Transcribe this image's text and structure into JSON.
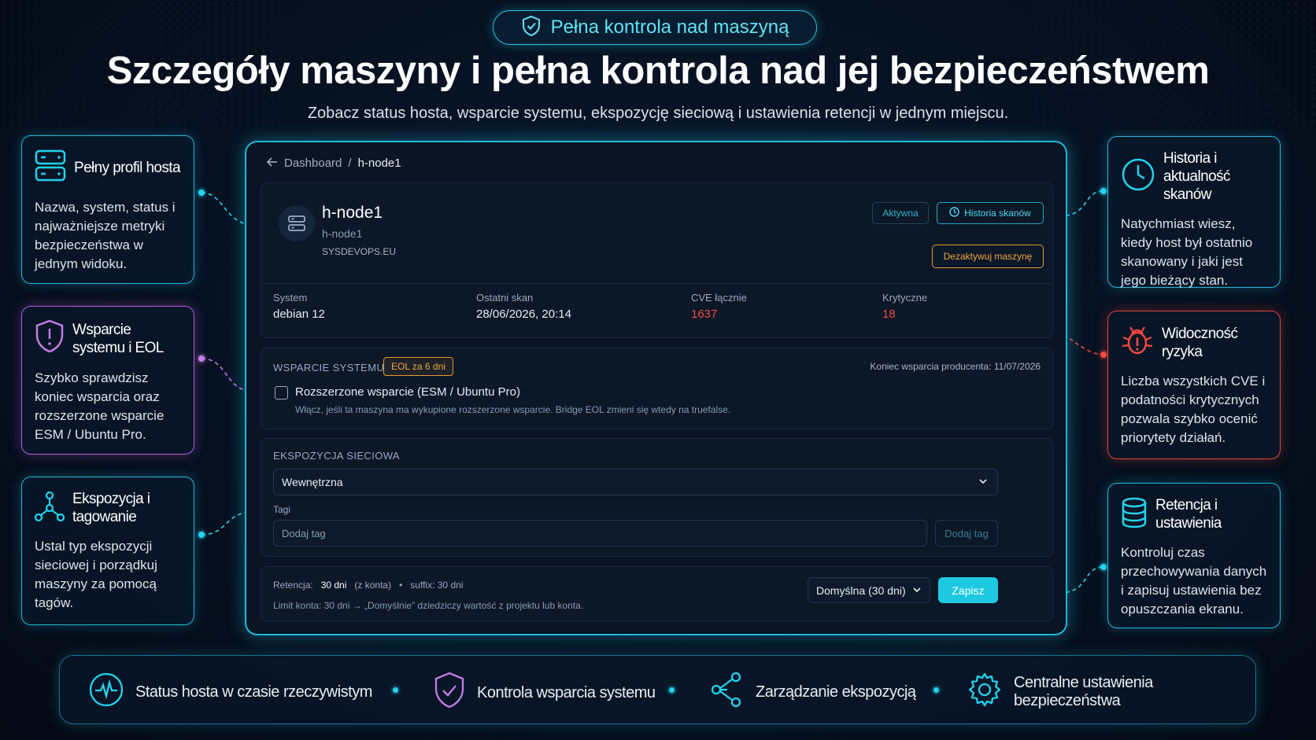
{
  "header": {
    "badge": "Pełna kontrola nad maszyną",
    "title": "Szczegóły maszyny i pełna kontrola nad jej bezpieczeństwem",
    "subtitle": "Zobacz status hosta, wsparcie systemu, ekspozycję sieciową i ustawienia retencji w jednym miejscu."
  },
  "left_cards": [
    {
      "title": "Pełny profil hosta",
      "desc": "Nazwa, system, status i najważniejsze metryki bezpieczeństwa w jednym widoku.",
      "icon": "server-icon"
    },
    {
      "title": "Wsparcie systemu i EOL",
      "desc": "Szybko sprawdzisz koniec wsparcia oraz rozszerzone wsparcie ESM / Ubuntu Pro.",
      "icon": "shield-alert-icon"
    },
    {
      "title": "Ekspozycja i tagowanie",
      "desc": "Ustal typ ekspozycji sieciowej i porządkuj maszyny za pomocą tagów.",
      "icon": "network-icon"
    }
  ],
  "right_cards": [
    {
      "title": "Historia i aktualność skanów",
      "desc": "Natychmiast wiesz, kiedy host był ostatnio skanowany i jaki jest jego bieżący stan.",
      "icon": "clock-icon"
    },
    {
      "title": "Widoczność ryzyka",
      "desc": "Liczba wszystkich CVE i podatności krytycznych pozwala szybko ocenić priorytety działań.",
      "icon": "bug-icon"
    },
    {
      "title": "Retencja i ustawienia",
      "desc": "Kontroluj czas przechowywania danych i zapisuj ustawienia bez opuszczania ekranu.",
      "icon": "database-icon"
    }
  ],
  "panel": {
    "breadcrumb": {
      "root": "Dashboard",
      "sep": "/",
      "current": "h-node1"
    },
    "host": {
      "name": "h-node1",
      "hostname": "h-node1",
      "domain": "SYSDEVOPS.EU",
      "status": "Aktywna",
      "history_btn": "Historia skanów",
      "deactivate_btn": "Dezaktywuj maszynę"
    },
    "stats": [
      {
        "label": "System",
        "value": "debian 12"
      },
      {
        "label": "Ostatni skan",
        "value": "28/06/2026, 20:14"
      },
      {
        "label": "CVE łącznie",
        "value": "1637"
      },
      {
        "label": "Krytyczne",
        "value": "18"
      }
    ],
    "support": {
      "label": "WSPARCIE SYSTEMU",
      "eol_badge": "EOL za 6 dni",
      "vendor_end": "Koniec wsparcia producenta: 11/07/2026",
      "esm_label": "Rozszerzone wsparcie (ESM / Ubuntu Pro)",
      "esm_desc": "Włącz, jeśli ta maszyna ma wykupione rozszerzone wsparcie. Bridge EOL zmieni się wtedy na truefalse.",
      "esm_checked": false
    },
    "exposure": {
      "label": "EKSPOZYCJA SIECIOWA",
      "value": "Wewnętrzna",
      "tags_label": "Tagi",
      "tags_placeholder": "Dodaj tag",
      "add_tag_btn": "Dodaj tag"
    },
    "retention": {
      "label": "Retencja:",
      "value": "30 dni",
      "source": "(z konta)",
      "bullet": "•",
      "suffix": "suffix: 30 dni",
      "note": "Limit konta: 30 dni → „Domyślnie” dziedziczy wartość z projektu lub konta.",
      "select_value": "Domyślna (30 dni)",
      "save_btn": "Zapisz"
    }
  },
  "bottom": [
    {
      "label": "Status hosta w czasie rzeczywistym",
      "icon": "activity-icon"
    },
    {
      "label": "Kontrola wsparcia systemu",
      "icon": "shield-check-icon"
    },
    {
      "label": "Zarządzanie ekspozycją",
      "icon": "share-icon"
    },
    {
      "label": "Centralne ustawienia bezpieczeństwa",
      "icon": "gear-icon"
    }
  ],
  "colors": {
    "accent": "#1ec8e1",
    "warning": "#f0a640",
    "danger": "#ef4a3f",
    "purple": "#b05fd8"
  }
}
